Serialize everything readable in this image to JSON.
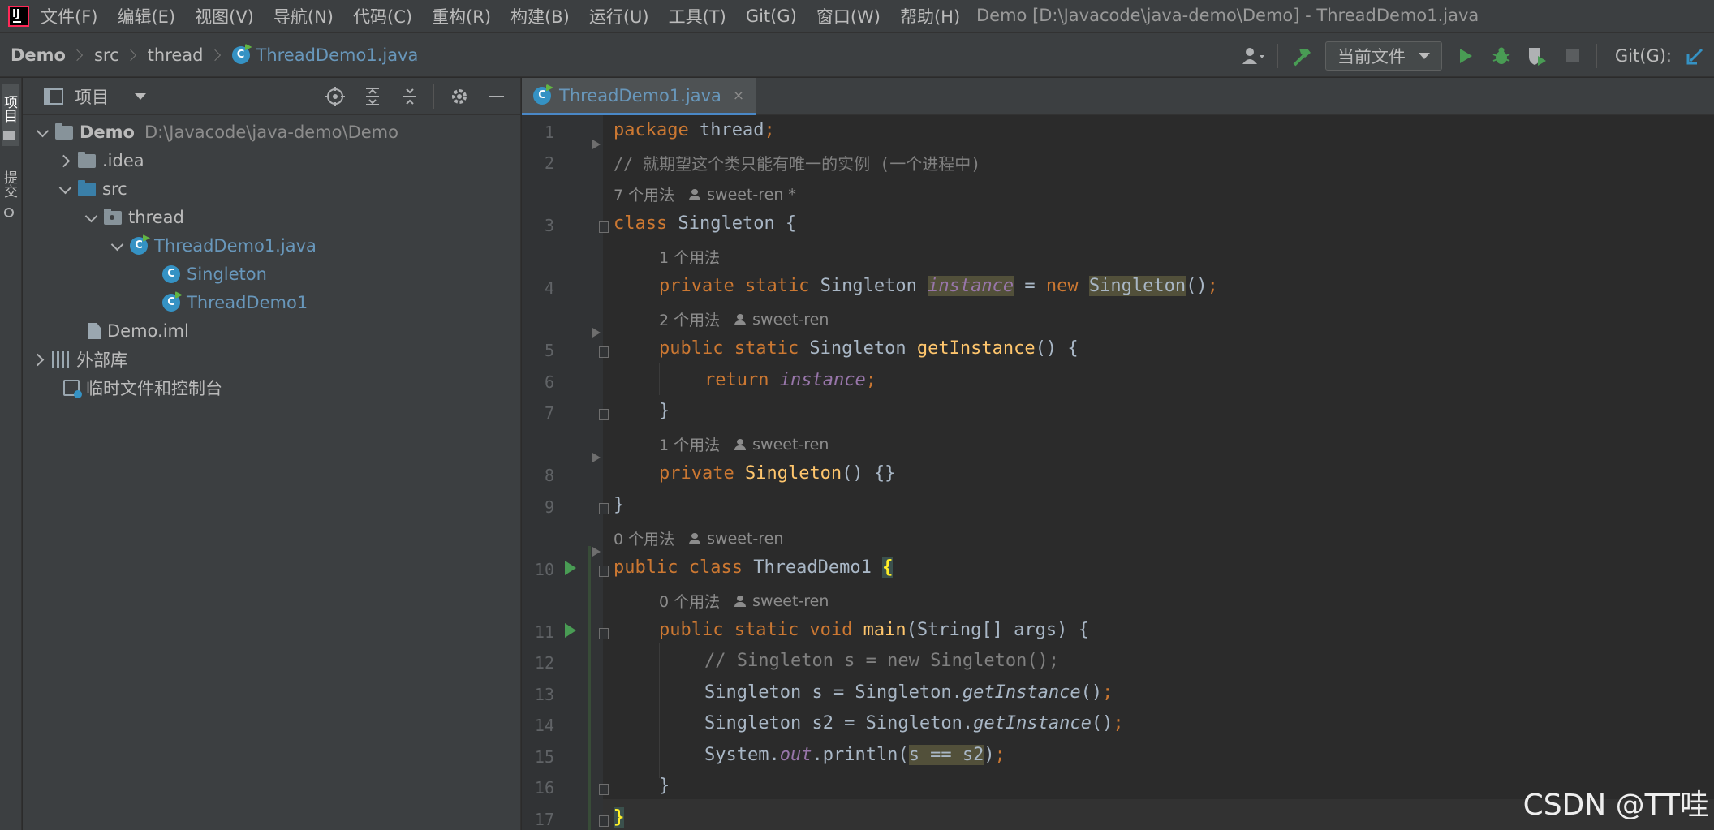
{
  "menu": {
    "items": [
      "文件(F)",
      "编辑(E)",
      "视图(V)",
      "导航(N)",
      "代码(C)",
      "重构(R)",
      "构建(B)",
      "运行(U)",
      "工具(T)",
      "Git(G)",
      "窗口(W)",
      "帮助(H)"
    ],
    "window_title": "Demo [D:\\Javacode\\java-demo\\Demo] - ThreadDemo1.java"
  },
  "breadcrumb": {
    "project": "Demo",
    "folder": "src",
    "package": "thread",
    "file": "ThreadDemo1.java"
  },
  "toolbar": {
    "run_config": "当前文件",
    "git_label": "Git(G):"
  },
  "tool_stripe": {
    "project_tab": "项目",
    "commit_tab": "提交"
  },
  "project_panel": {
    "title": "项目",
    "root_name": "Demo",
    "root_path": "D:\\Javacode\\java-demo\\Demo",
    "idea": ".idea",
    "src": "src",
    "thread": "thread",
    "file": "ThreadDemo1.java",
    "class_singleton": "Singleton",
    "class_threaddemo": "ThreadDemo1",
    "iml": "Demo.iml",
    "external_libs": "外部库",
    "scratches": "临时文件和控制台"
  },
  "editor": {
    "tab_label": "ThreadDemo1.java",
    "tab_close": "×",
    "line_numbers": [
      "1",
      "2",
      "3",
      "4",
      "5",
      "6",
      "7",
      "8",
      "9",
      "10",
      "11",
      "12",
      "13",
      "14",
      "15",
      "16",
      "17"
    ],
    "hints": {
      "h1": {
        "usage": "7 个用法",
        "user": "sweet-ren *"
      },
      "h2": {
        "usage": "1 个用法",
        "user": ""
      },
      "h3": {
        "usage": "2 个用法",
        "user": "sweet-ren"
      },
      "h4": {
        "usage": "1 个用法",
        "user": "sweet-ren"
      },
      "h5": {
        "usage": "0 个用法",
        "user": "sweet-ren"
      },
      "h6": {
        "usage": "0 个用法",
        "user": "sweet-ren"
      }
    },
    "code": {
      "l1_kw": "package",
      "l1_rest": " thread",
      "l1_semi": ";",
      "l2": "// 就期望这个类只能有唯一的实例 (一个进程中)",
      "l3_kw": "class",
      "l3_rest": " Singleton {",
      "l4_kw": "private static",
      "l4_type": " Singleton ",
      "l4_field": "instance",
      "l4_eq": " = ",
      "l4_new": "new",
      "l4_ctor": "Singleton",
      "l4_paren": "()",
      "l4_semi": ";",
      "l5_kw": "public static",
      "l5_type": " Singleton ",
      "l5_fn": "getInstance",
      "l5_rest": "() {",
      "l6_kw": "return",
      "l6_field": "instance",
      "l6_semi": ";",
      "l7": "}",
      "l8_kw": "private",
      "l8_fn": "Singleton",
      "l8_rest": "() {}",
      "l9": "}",
      "l10_kw": "public class",
      "l10_rest": " ThreadDemo1 ",
      "l10_brace": "{",
      "l11_kw": "public static void",
      "l11_fn": "main",
      "l11_rest": "(String[] args) {",
      "l12": "// Singleton s = new Singleton();",
      "l13_a": "Singleton s = Singleton.",
      "l13_m": "getInstance",
      "l13_b": "()",
      "l13_semi": ";",
      "l14_a": "Singleton s2 = Singleton.",
      "l14_m": "getInstance",
      "l14_b": "()",
      "l14_semi": ";",
      "l15_a": "System.",
      "l15_out": "out",
      "l15_b": ".println(",
      "l15_hl": "s == s2",
      "l15_c": ")",
      "l15_semi": ";",
      "l16": "}",
      "l17": "}"
    }
  },
  "watermark": "CSDN @TT哇",
  "colors": {
    "keyword": "#cc7832",
    "method": "#ffc66d",
    "field": "#9876aa",
    "comment": "#808080",
    "text": "#a9b7c6",
    "file_blue": "#6897bb",
    "run_green": "#499c54"
  }
}
